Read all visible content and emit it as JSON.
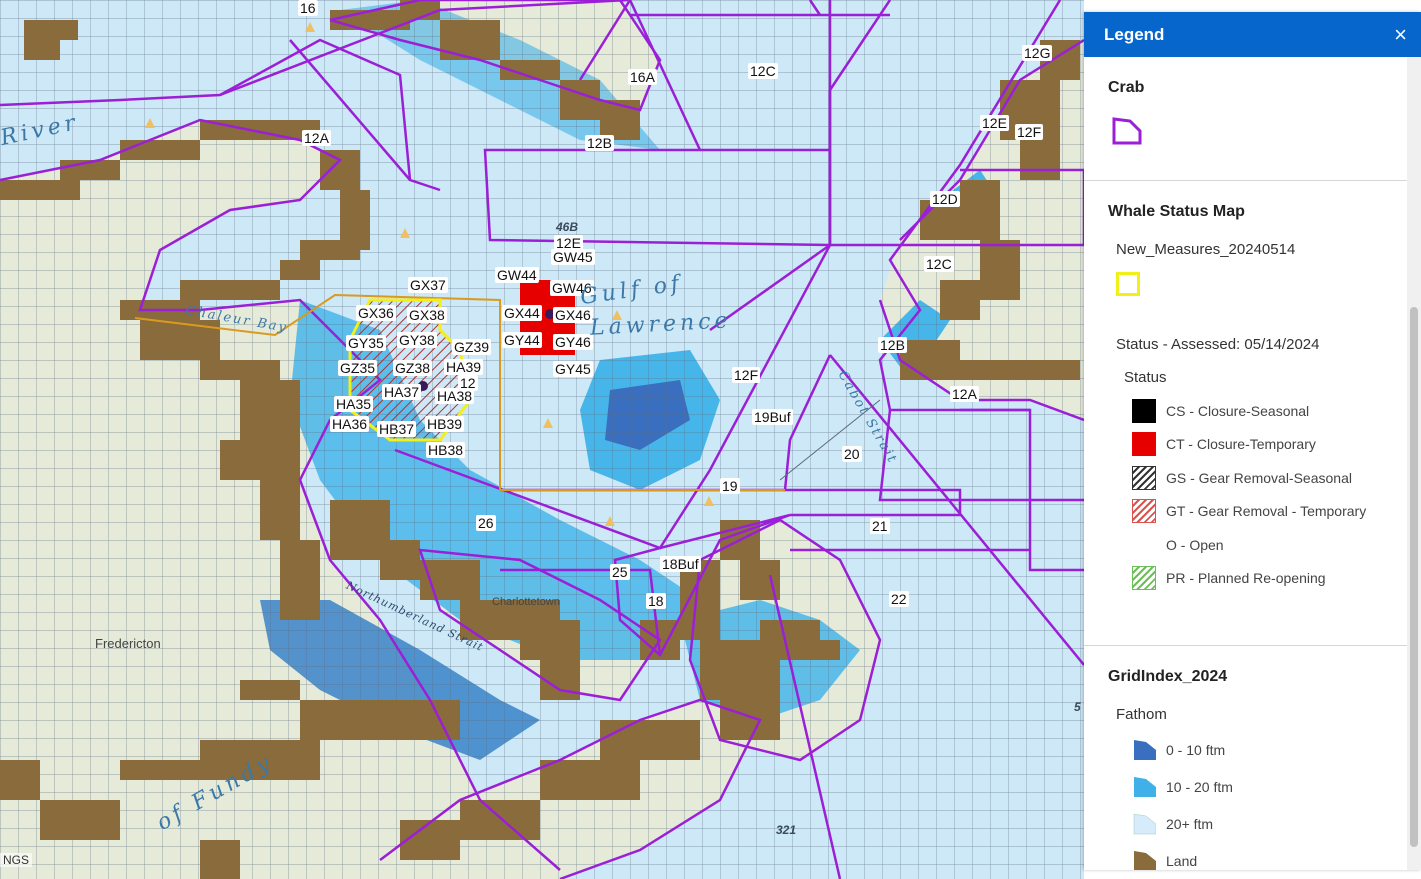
{
  "legend": {
    "title": "Legend",
    "close_icon": "×",
    "crab": {
      "title": "Crab",
      "line_color": "#9b1fd6"
    },
    "whale": {
      "title": "Whale Status Map",
      "layer_name": "New_Measures_20240514",
      "layer_color": "#f2ef19",
      "status_heading": "Status - Assessed: 05/14/2024",
      "status_sub": "Status",
      "items": [
        {
          "label": "CS - Closure-Seasonal",
          "color": "#000000"
        },
        {
          "label": "CT - Closure-Temporary",
          "color": "#e60000"
        },
        {
          "label": "GS - Gear Removal-Seasonal",
          "color": "#333333"
        },
        {
          "label": "GT - Gear Removal - Temporary",
          "color": "#d9534f"
        },
        {
          "label": "O - Open",
          "color": ""
        },
        {
          "label": "PR - Planned Re-opening",
          "color": "#6bbf59"
        }
      ]
    },
    "grid": {
      "title": "GridIndex_2024",
      "sub": "Fathom",
      "items": [
        {
          "label": "0 - 10 ftm",
          "color": "#3a6fbf"
        },
        {
          "label": "10 - 20 ftm",
          "color": "#3fb1e8"
        },
        {
          "label": "20+ ftm",
          "color": "#d6ecfa"
        },
        {
          "label": "Land",
          "color": "#8a6b3c"
        }
      ]
    }
  },
  "map": {
    "attribution": "NGS",
    "zone_labels": [
      "16",
      "16A",
      "12C",
      "12G",
      "12A",
      "12B",
      "12E",
      "12F",
      "12D",
      "12C",
      "12B",
      "12A",
      "12F",
      "19Buf",
      "20",
      "19",
      "21",
      "22",
      "26",
      "25",
      "18Buf",
      "18",
      "12E",
      "GW45",
      "GW44",
      "GW46",
      "GX44",
      "GX46",
      "GY44",
      "GY46",
      "GY45",
      "GX37",
      "GX36",
      "GX38",
      "GY35",
      "GY38",
      "GZ39",
      "GZ35",
      "GZ38",
      "HA39",
      "HA37",
      "HA35",
      "HA38",
      "HA36",
      "HB37",
      "HB39",
      "HB38",
      "12",
      "46B"
    ],
    "water_labels": [
      "River",
      "Gulf of",
      "Lawrence",
      "Chaleur Bay",
      "of Fundy",
      "Cabot Strait",
      "Northumberland Strait"
    ],
    "place_labels": [
      "Fredericton",
      "Charlottetown"
    ],
    "depth_labels": [
      "321",
      "5"
    ]
  }
}
